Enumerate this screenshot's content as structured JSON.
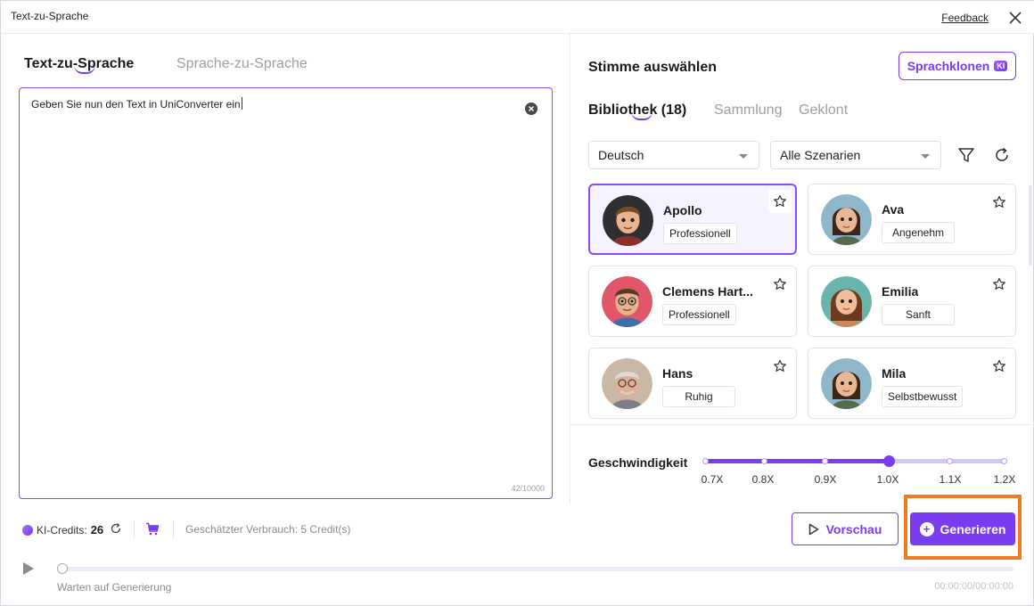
{
  "window": {
    "title": "Text-zu-Sprache",
    "feedback": "Feedback"
  },
  "left": {
    "tabs": [
      {
        "label": "Text-zu-Sprache",
        "active": true
      },
      {
        "label": "Sprache-zu-Sprache",
        "active": false
      }
    ],
    "editor": {
      "text": "Geben Sie nun den Text in UniConverter ein",
      "counter": "42/10000"
    }
  },
  "right": {
    "heading": "Stimme auswählen",
    "clone_button": "Sprachklonen",
    "clone_badge": "KI",
    "library_tabs": [
      {
        "label": "Bibliothek (18)",
        "active": true
      },
      {
        "label": "Sammlung",
        "active": false
      },
      {
        "label": "Geklont",
        "active": false
      }
    ],
    "language_select": "Deutsch",
    "scenario_select": "Alle Szenarien",
    "voices": [
      {
        "name": "Apollo",
        "tag": "Professionell",
        "selected": true
      },
      {
        "name": "Ava",
        "tag": "Angenehm",
        "selected": false
      },
      {
        "name": "Clemens Hart...",
        "tag": "Professionell",
        "selected": false
      },
      {
        "name": "Emilia",
        "tag": "Sanft",
        "selected": false
      },
      {
        "name": "Hans",
        "tag": "Ruhig",
        "selected": false
      },
      {
        "name": "Mila",
        "tag": "Selbstbewusst",
        "selected": false
      }
    ],
    "speed": {
      "label": "Geschwindigkeit",
      "ticks": [
        "0.7X",
        "0.8X",
        "0.9X",
        "1.0X",
        "1.1X",
        "1.2X"
      ],
      "selected_value": "1.0X"
    }
  },
  "bottom": {
    "credits_label": "KI-Credits:",
    "credits_value": "26",
    "estimate": "Geschätzter Verbrauch: 5 Credit(s)",
    "preview_button": "Vorschau",
    "generate_button": "Generieren",
    "status": "Warten auf Generierung",
    "time": "00:00:00/00:00:00"
  },
  "colors": {
    "accent": "#7b3cf0",
    "highlight": "#f47b20"
  }
}
